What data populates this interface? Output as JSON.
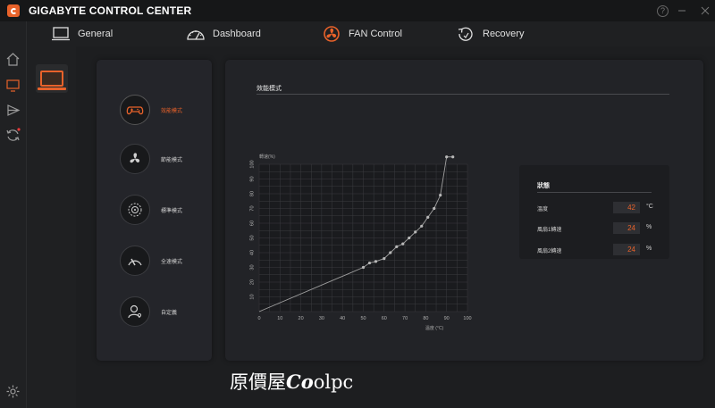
{
  "app": {
    "title": "GIGABYTE CONTROL CENTER"
  },
  "window": {
    "help": "?"
  },
  "nav": {
    "tabs": [
      {
        "label": "General",
        "icon": "laptop-icon"
      },
      {
        "label": "Dashboard",
        "icon": "gauge-icon"
      },
      {
        "label": "FAN Control",
        "icon": "fan-icon",
        "active": true
      },
      {
        "label": "Recovery",
        "icon": "restore-icon"
      }
    ]
  },
  "fan": {
    "section_title": "效能模式",
    "modes": [
      {
        "label": "效能模式",
        "icon": "gamepad-icon",
        "active": true
      },
      {
        "label": "節能模式",
        "icon": "fan-icon"
      },
      {
        "label": "標準模式",
        "icon": "balance-icon"
      },
      {
        "label": "全速模式",
        "icon": "speedometer-icon"
      },
      {
        "label": "自定義",
        "icon": "user-icon"
      }
    ],
    "status": {
      "title": "狀態",
      "rows": [
        {
          "label": "溫度",
          "value": "42",
          "unit": "°C"
        },
        {
          "label": "風扇1轉速",
          "value": "24",
          "unit": "%"
        },
        {
          "label": "風扇2轉速",
          "value": "24",
          "unit": "%"
        }
      ]
    }
  },
  "chart_data": {
    "type": "line",
    "xlabel": "溫度 (°C)",
    "ylabel": "轉速(%)",
    "xlim": [
      0,
      100
    ],
    "ylim": [
      0,
      100
    ],
    "xticks": [
      "0",
      "10",
      "20",
      "30",
      "40",
      "50",
      "60",
      "70",
      "80",
      "90",
      "100"
    ],
    "yticks": [
      "10",
      "20",
      "30",
      "40",
      "50",
      "60",
      "70",
      "80",
      "90",
      "100"
    ],
    "grid": true,
    "series": [
      {
        "x": [
          0,
          50,
          53,
          56,
          60,
          63,
          66,
          69,
          72,
          75,
          78,
          81,
          84,
          87,
          90,
          93
        ],
        "y": [
          0,
          30,
          33,
          34,
          36,
          40,
          44,
          46,
          50,
          54,
          58,
          64,
          70,
          79,
          105,
          107
        ]
      }
    ],
    "color": "#a0a0a0"
  },
  "watermark": {
    "prefix": "原價屋",
    "brand_a": "Co",
    "brand_b": "olpc"
  },
  "colors": {
    "accent": "#e8622a"
  }
}
